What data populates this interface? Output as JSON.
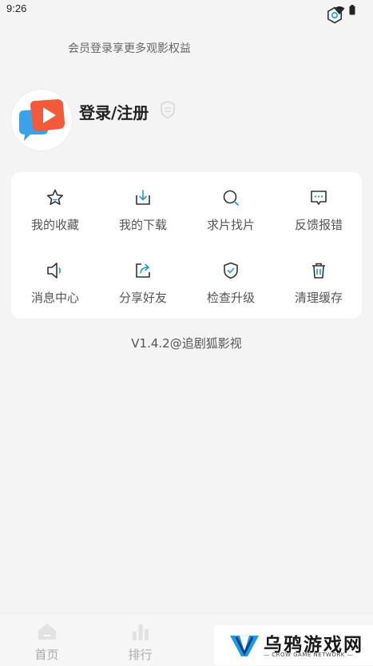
{
  "status_bar": {
    "time": "9:26"
  },
  "profile": {
    "title": "登录/注册",
    "subtitle": "会员登录享更多观影权益"
  },
  "menu": {
    "items": [
      {
        "label": "我的收藏",
        "icon": "star-icon"
      },
      {
        "label": "我的下载",
        "icon": "download-icon"
      },
      {
        "label": "求片找片",
        "icon": "search-icon"
      },
      {
        "label": "反馈报错",
        "icon": "feedback-icon"
      },
      {
        "label": "消息中心",
        "icon": "speaker-icon"
      },
      {
        "label": "分享好友",
        "icon": "share-icon"
      },
      {
        "label": "检查升级",
        "icon": "shield-check-icon"
      },
      {
        "label": "清理缓存",
        "icon": "trash-icon"
      }
    ]
  },
  "version": "V1.4.2@追剧狐影视",
  "bottom_nav": {
    "tabs": [
      {
        "label": "首页",
        "icon": "home-icon"
      },
      {
        "label": "排行",
        "icon": "bar-chart-icon"
      }
    ]
  },
  "watermark": {
    "title": "乌鸦游戏网",
    "subtitle": "— CROW GAME NETWORK —"
  },
  "colors": {
    "accent": "#1e9be0",
    "icon_dark": "#333333",
    "background": "#f4f4f4"
  }
}
